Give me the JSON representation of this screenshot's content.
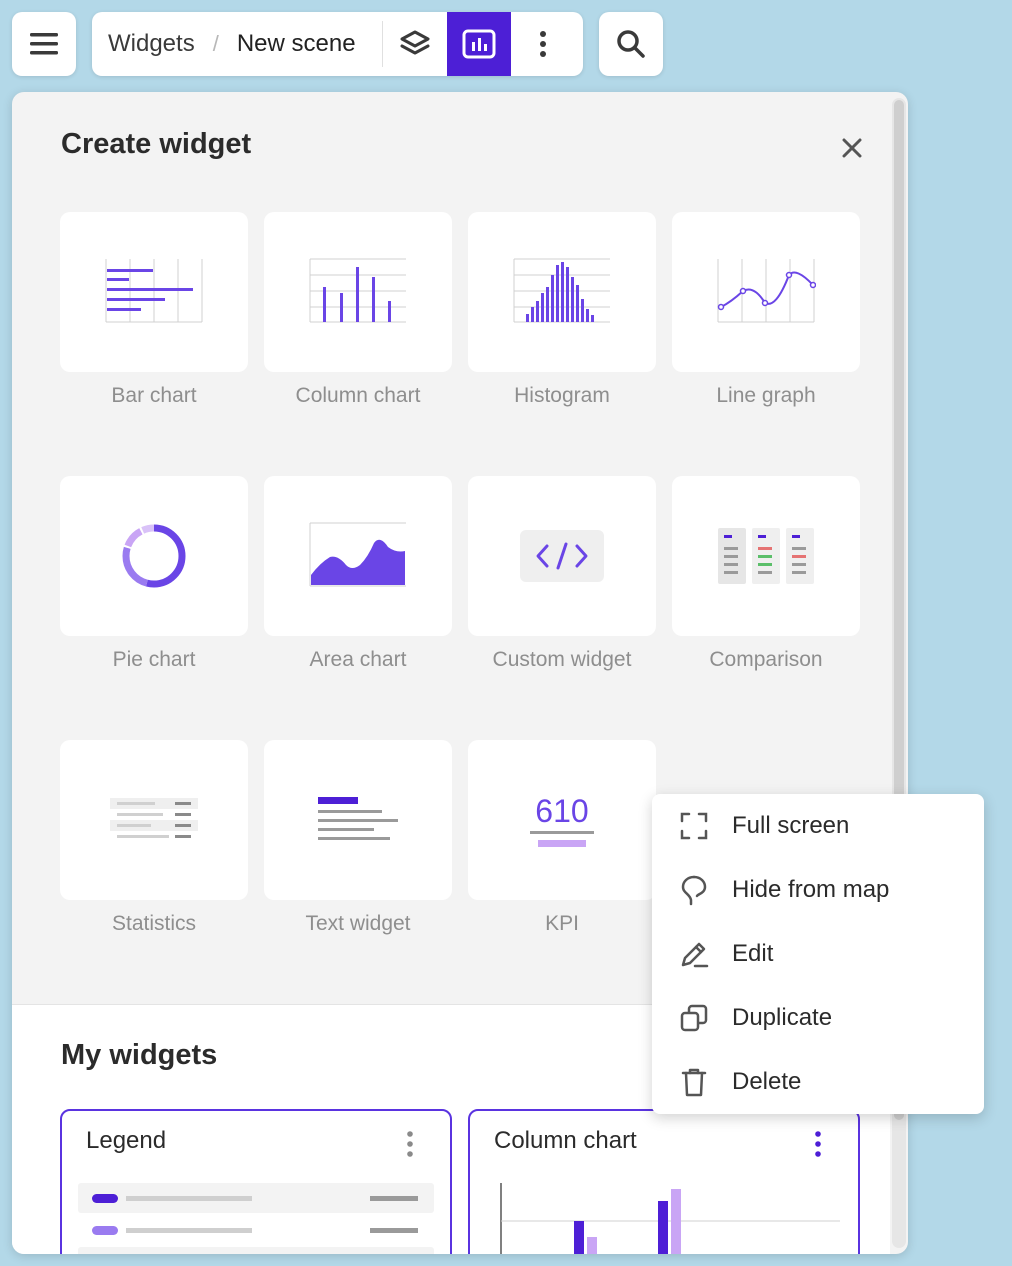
{
  "breadcrumb": {
    "root": "Widgets",
    "separator": "/",
    "current": "New scene"
  },
  "panel": {
    "title": "Create widget"
  },
  "widget_types": [
    {
      "label": "Bar chart",
      "icon": "bar-chart-icon"
    },
    {
      "label": "Column chart",
      "icon": "column-chart-icon"
    },
    {
      "label": "Histogram",
      "icon": "histogram-icon"
    },
    {
      "label": "Line graph",
      "icon": "line-graph-icon"
    },
    {
      "label": "Pie chart",
      "icon": "pie-chart-icon"
    },
    {
      "label": "Area chart",
      "icon": "area-chart-icon"
    },
    {
      "label": "Custom widget",
      "icon": "code-icon"
    },
    {
      "label": "Comparison",
      "icon": "comparison-icon"
    },
    {
      "label": "Statistics",
      "icon": "statistics-icon"
    },
    {
      "label": "Text widget",
      "icon": "text-icon"
    },
    {
      "label": "KPI",
      "icon": "kpi-icon"
    }
  ],
  "kpi_preview_value": "610",
  "my_widgets": {
    "title": "My widgets",
    "items": [
      {
        "title": "Legend"
      },
      {
        "title": "Column chart"
      }
    ]
  },
  "context_menu": {
    "items": [
      {
        "label": "Full screen",
        "icon": "fullscreen-icon"
      },
      {
        "label": "Hide from map",
        "icon": "hide-from-map-icon"
      },
      {
        "label": "Edit",
        "icon": "pencil-icon"
      },
      {
        "label": "Duplicate",
        "icon": "duplicate-icon"
      },
      {
        "label": "Delete",
        "icon": "trash-icon"
      }
    ]
  },
  "colors": {
    "accent": "#4d1fd6",
    "accent_light": "#c9a5f5",
    "line": "#6a45e6"
  }
}
